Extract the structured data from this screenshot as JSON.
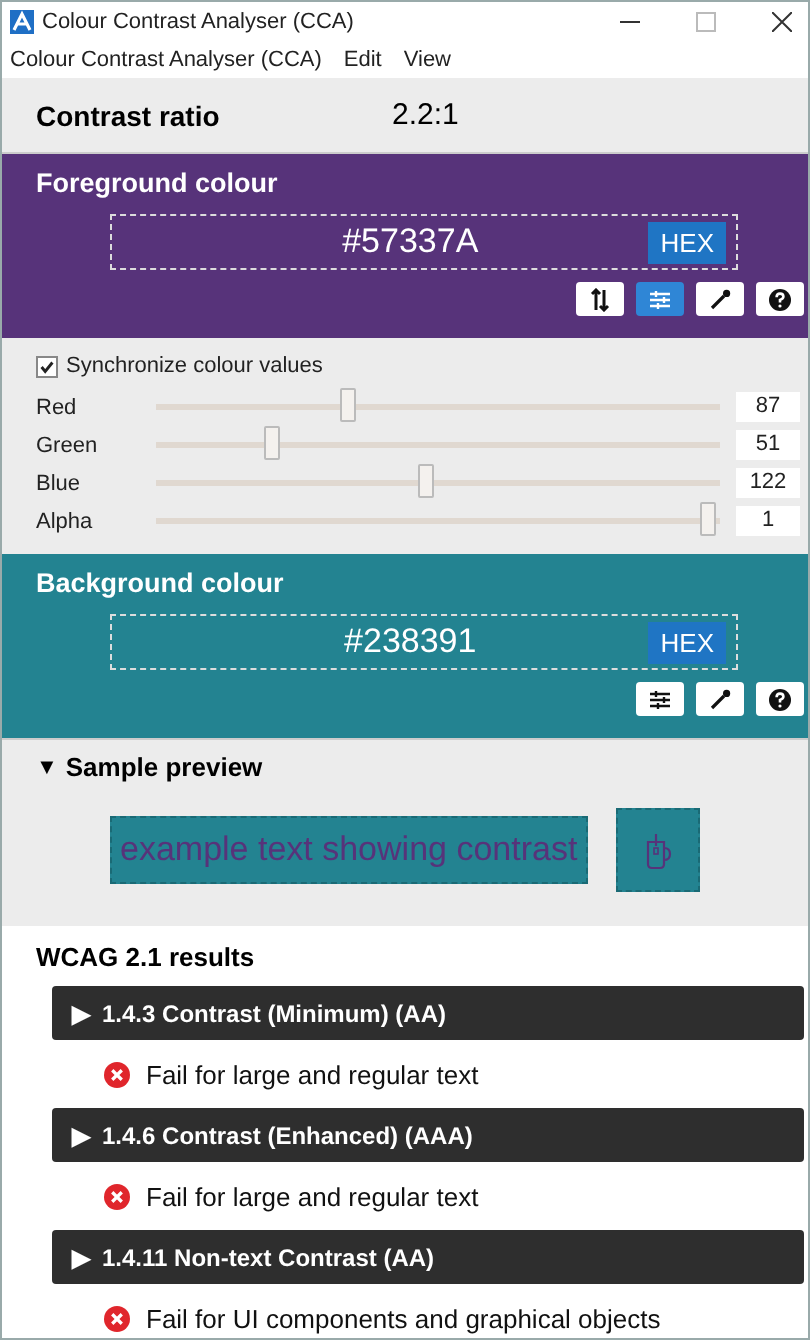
{
  "window": {
    "title": "Colour Contrast Analyser (CCA)"
  },
  "menu": [
    "Colour Contrast Analyser (CCA)",
    "Edit",
    "View"
  ],
  "contrast": {
    "label": "Contrast ratio",
    "value": "2.2:1"
  },
  "foreground": {
    "title": "Foreground colour",
    "value": "#57337A",
    "format": "HEX",
    "tools": [
      {
        "kind": "swap",
        "selected": false
      },
      {
        "kind": "sliders",
        "selected": true
      },
      {
        "kind": "picker",
        "selected": false
      },
      {
        "kind": "help",
        "selected": false
      }
    ]
  },
  "sync": {
    "label": "Synchronize colour values",
    "checked": true
  },
  "sliders": [
    {
      "label": "Red",
      "level": 0.34,
      "value": "87"
    },
    {
      "label": "Green",
      "level": 0.2,
      "value": "51"
    },
    {
      "label": "Blue",
      "level": 0.48,
      "value": "122"
    },
    {
      "label": "Alpha",
      "level": 1,
      "value": "1"
    }
  ],
  "background": {
    "title": "Background colour",
    "value": "#238391",
    "format": "HEX",
    "tools": [
      {
        "kind": "sliders",
        "selected": false
      },
      {
        "kind": "picker",
        "selected": false
      },
      {
        "kind": "help",
        "selected": false
      }
    ]
  },
  "preview": {
    "arrow": "▼",
    "title": "Sample preview",
    "sample": "example text showing contrast"
  },
  "results": {
    "title": "WCAG 2.1 results",
    "items": [
      {
        "arrow": "▶",
        "heading": "1.4.3 Contrast (Minimum) (AA)",
        "kind": "fail",
        "result": "Fail for large and regular text"
      },
      {
        "arrow": "▶",
        "heading": "1.4.6 Contrast (Enhanced) (AAA)",
        "kind": "fail",
        "result": "Fail for large and regular text"
      },
      {
        "arrow": "▶",
        "heading": "1.4.11 Non-text Contrast (AA)",
        "kind": "fail",
        "result": "Fail for UI components and graphical objects"
      }
    ]
  }
}
